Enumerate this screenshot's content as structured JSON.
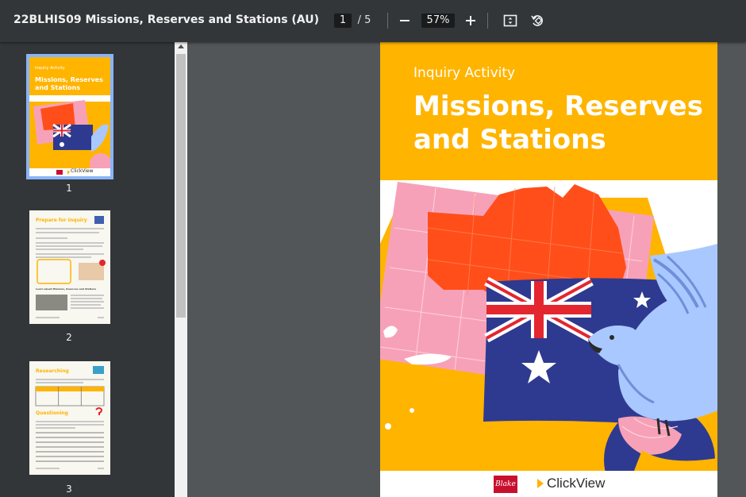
{
  "toolbar": {
    "title": "22BLHIS09 Missions, Reserves and Stations (AU)",
    "current_page": "1",
    "page_separator": "/  5",
    "zoom": "57%",
    "icons": [
      "minus-icon",
      "plus-icon",
      "fit-page-icon",
      "rotate-icon"
    ]
  },
  "sidebar": {
    "thumbnails": [
      {
        "label": "1",
        "subtitle": "Inquiry Activity",
        "title": "Missions, Reserves and Stations",
        "brand": "ClickView"
      },
      {
        "label": "2",
        "heading": "Prepare for Inquiry",
        "sub_heading": "Learn about Missions, Reserves and Stations"
      },
      {
        "label": "3",
        "heading": "Researching",
        "heading2": "Questioning"
      }
    ]
  },
  "page": {
    "subtitle": "Inquiry Activity",
    "title": "Missions, Reserves and Stations",
    "footer": {
      "publisher": "Blake",
      "brand": "ClickView"
    }
  },
  "colors": {
    "toolbar_bg": "#323639",
    "viewer_bg": "#525659",
    "header_yellow": "#ffb400",
    "map_orange": "#ff4e1a",
    "map_pink": "#f7a1b8",
    "flag_blue": "#2e3a8f",
    "flag_red": "#e4262f",
    "bird_blue": "#a9c8ff",
    "selected_outline": "#8ab4f8"
  }
}
